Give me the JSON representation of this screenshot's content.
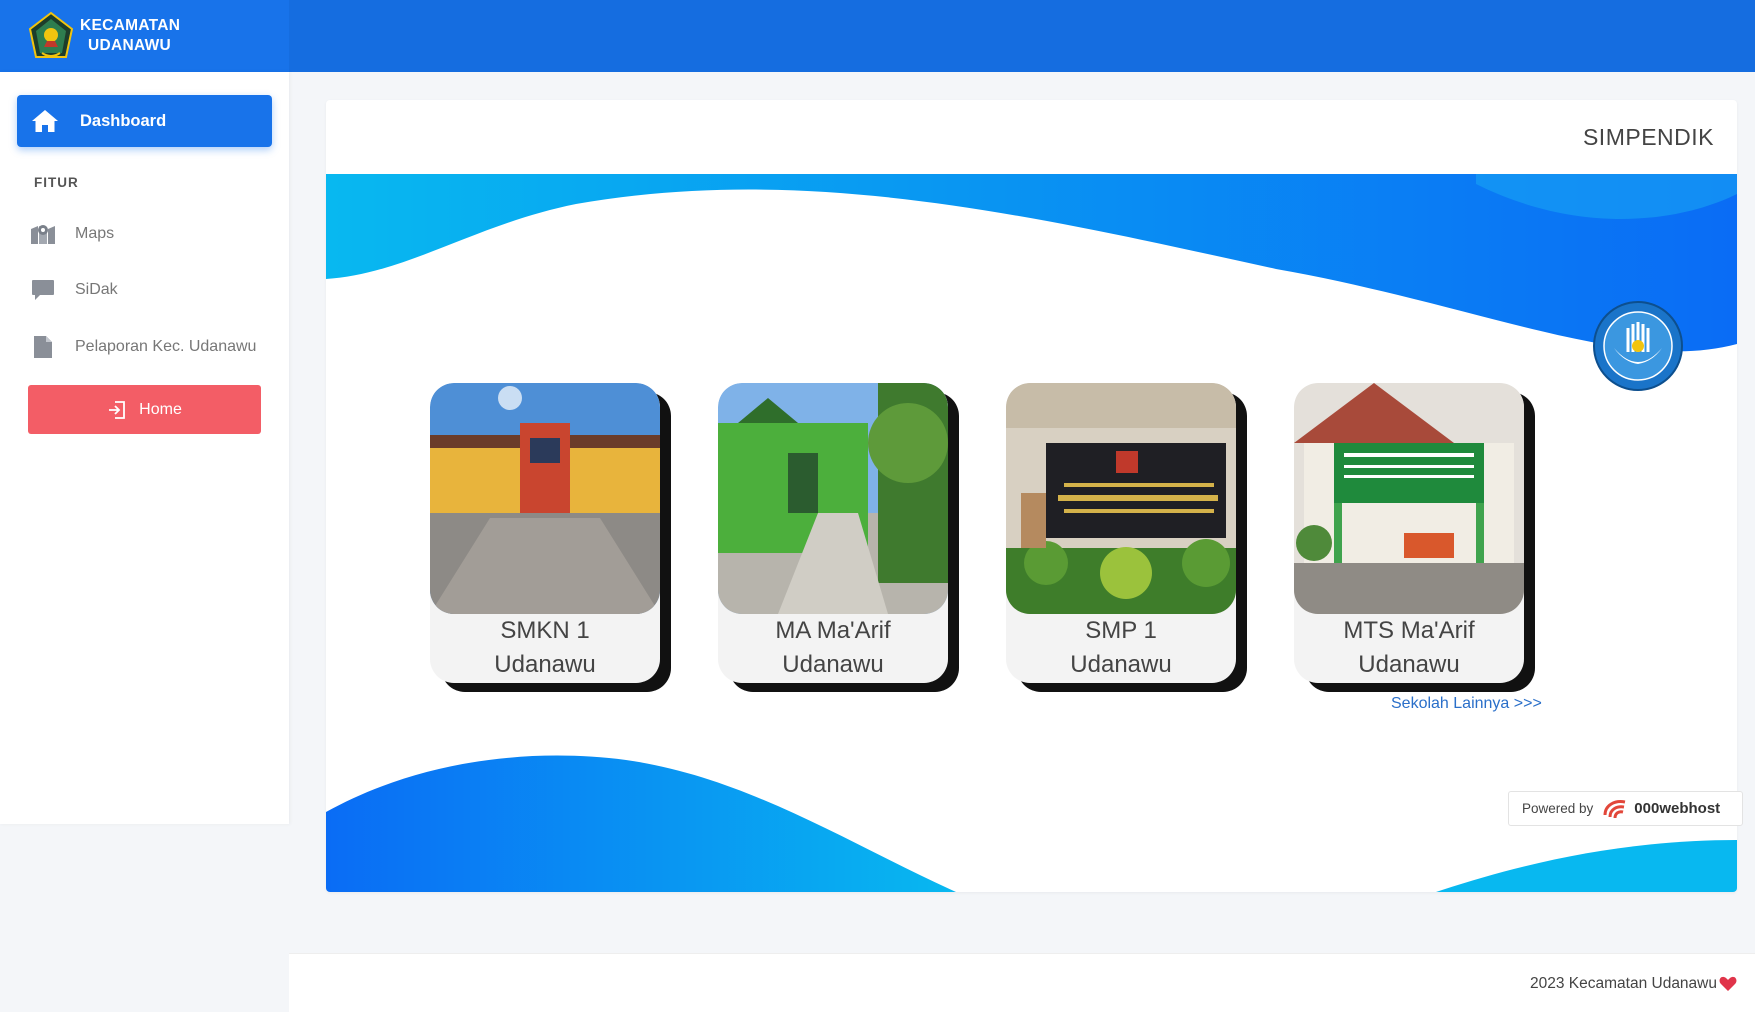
{
  "brand": {
    "line1": "KECAMATAN",
    "line2": "UDANAWU",
    "logo_icon": "regency-emblem-icon"
  },
  "sidebar": {
    "active_item": {
      "label": "Dashboard",
      "icon": "home-icon"
    },
    "section_label": "FITUR",
    "items": [
      {
        "label": "Maps",
        "icon": "map-icon"
      },
      {
        "label": "SiDak",
        "icon": "comment-icon"
      },
      {
        "label": "Pelaporan Kec. Udanawu",
        "icon": "file-icon"
      }
    ],
    "home_button": {
      "label": "Home",
      "icon": "sign-in-icon"
    }
  },
  "card": {
    "title": "SIMPENDIK",
    "emblem_icon": "tut-wuri-handayani-emblem-icon",
    "schools": [
      {
        "line1": "SMKN 1",
        "line2": "Udanawu"
      },
      {
        "line1": "MA Ma'Arif",
        "line2": "Udanawu"
      },
      {
        "line1": "SMP 1",
        "line2": "Udanawu"
      },
      {
        "line1": "MTS Ma'Arif",
        "line2": "Udanawu"
      }
    ],
    "more_link": "Sekolah Lainnya >>>"
  },
  "powered": {
    "prefix": "Powered by",
    "host": "000webhost"
  },
  "footer": {
    "text": "2023 Kecamatan Udanawu"
  },
  "colors": {
    "primary": "#1873ea",
    "topbar": "#156de0",
    "danger": "#f35d66",
    "wave_light": "#08b8f0",
    "wave_dark": "#0a6cf5"
  }
}
